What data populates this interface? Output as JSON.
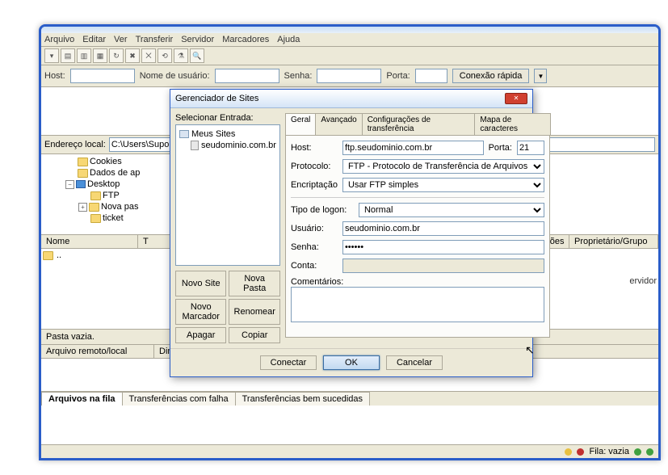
{
  "menu": {
    "arquivo": "Arquivo",
    "editar": "Editar",
    "ver": "Ver",
    "transferir": "Transferir",
    "servidor": "Servidor",
    "marcadores": "Marcadores",
    "ajuda": "Ajuda"
  },
  "quick": {
    "host": "Host:",
    "user": "Nome de usuário:",
    "pass": "Senha:",
    "port": "Porta:",
    "connect": "Conexão rápida",
    "drop": "▼"
  },
  "addr": {
    "label": "Endereço local:",
    "value": "C:\\Users\\Suporte\\Deskt"
  },
  "tree": {
    "cookies": "Cookies",
    "dados": "Dados de ap",
    "desktop": "Desktop",
    "ftp": "FTP",
    "nova": "Nova pas",
    "ticket": "ticket"
  },
  "list": {
    "nome": "Nome",
    "t": "T",
    "permissoes": "Permissões",
    "owner": "Proprietário/Grupo",
    "up": "..",
    "servidor": "ervidor"
  },
  "status": {
    "empty": "Pasta vazia."
  },
  "transfer": {
    "remote": "Arquivo remoto/local",
    "dir": "Dire"
  },
  "tabs": {
    "fila": "Arquivos na fila",
    "falha": "Transferências com falha",
    "sucesso": "Transferências bem sucedidas"
  },
  "bar": {
    "fila": "Fila: vazia"
  },
  "dlg": {
    "title": "Gerenciador de Sites",
    "select": "Selecionar Entrada:",
    "root": "Meus Sites",
    "entry": "seudominio.com.br",
    "btns": {
      "novo": "Novo Site",
      "pasta": "Nova Pasta",
      "marcador": "Novo Marcador",
      "renomear": "Renomear",
      "apagar": "Apagar",
      "copiar": "Copiar"
    },
    "tabs": {
      "geral": "Geral",
      "avancado": "Avançado",
      "config": "Configurações de transferência",
      "mapa": "Mapa de caracteres"
    },
    "form": {
      "host": "Host:",
      "host_v": "ftp.seudominio.com.br",
      "porta": "Porta:",
      "porta_v": "21",
      "protocolo": "Protocolo:",
      "protocolo_v": "FTP - Protocolo de Transferência de Arquivos",
      "encript": "Encriptação",
      "encript_v": "Usar FTP simples",
      "tipo": "Tipo de logon:",
      "tipo_v": "Normal",
      "usuario": "Usuário:",
      "usuario_v": "seudominio.com.br",
      "senha": "Senha:",
      "senha_v": "••••••",
      "conta": "Conta:",
      "conta_v": "",
      "comentarios": "Comentários:"
    },
    "actions": {
      "conectar": "Conectar",
      "ok": "OK",
      "cancelar": "Cancelar"
    }
  }
}
